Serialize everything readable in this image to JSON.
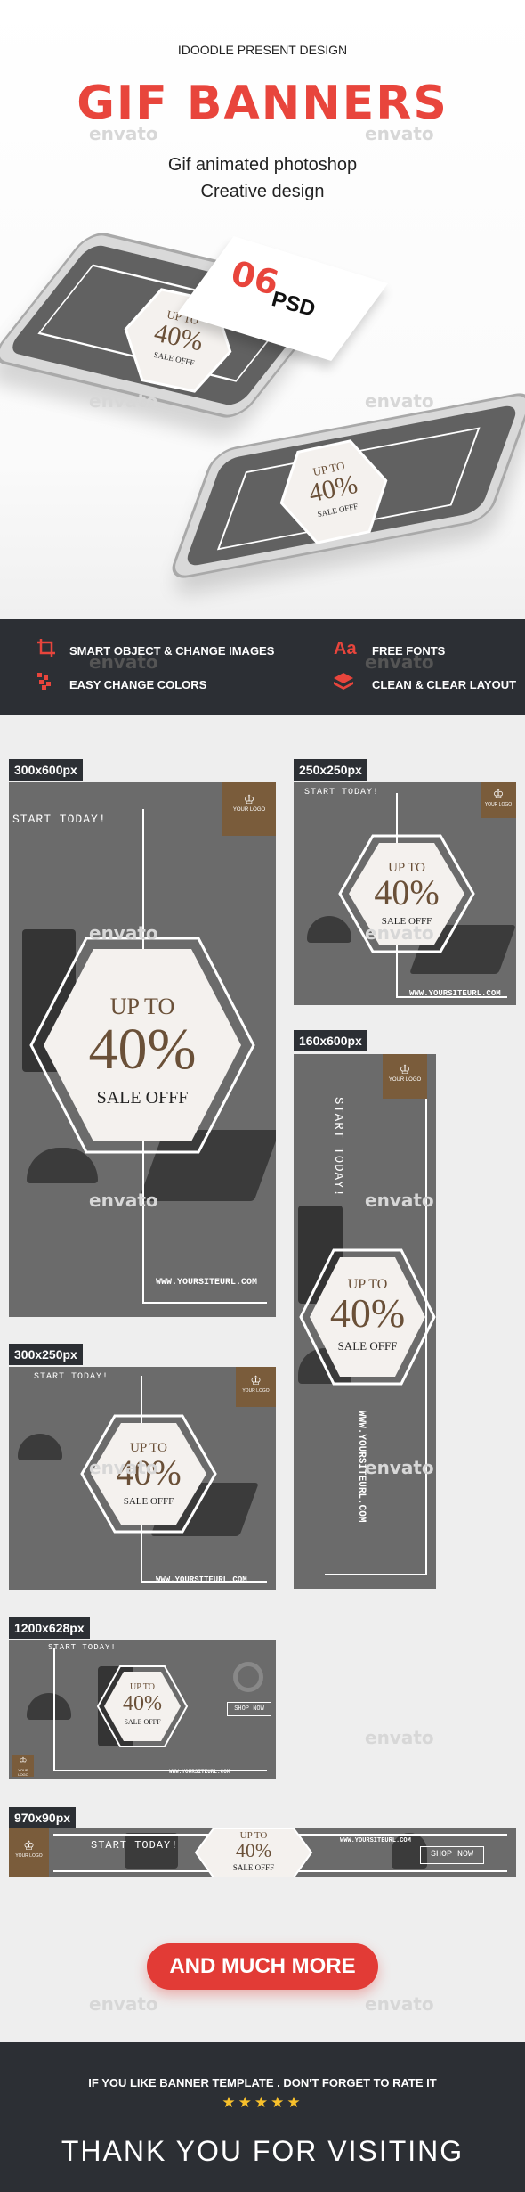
{
  "header": {
    "presenter": "IDOODLE PRESENT DESIGN",
    "title": "GIF BANNERS",
    "subtitle_1": "Gif animated photoshop",
    "subtitle_2": "Creative design"
  },
  "watermark": "envato",
  "badge": {
    "number": "06",
    "label": "PSD"
  },
  "features": {
    "items": [
      {
        "icon": "crop-icon",
        "label": "SMART OBJECT & CHANGE IMAGES"
      },
      {
        "icon": "palette-icon",
        "label": "EASY CHANGE COLORS"
      },
      {
        "icon": "font-icon",
        "label": "FREE FONTS",
        "glyph": "Aa"
      },
      {
        "icon": "layers-icon",
        "label": "CLEAN & CLEAR LAYOUT"
      }
    ]
  },
  "banner_text": {
    "start": "START TODAY!",
    "up_to": "UP TO",
    "percent": "40%",
    "sale": "SALE OFFF",
    "url": "WWW.YOURSITEURL.COM",
    "logo": "YOUR LOGO",
    "shop": "SHOP NOW"
  },
  "sizes": {
    "s300x600": "300x600px",
    "s250x250": "250x250px",
    "s160x600": "160x600px",
    "s300x250": "300x250px",
    "s1200x628": "1200x628px",
    "s970x90": "970x90px"
  },
  "cta": {
    "label": "AND MUCH MORE"
  },
  "footer": {
    "rate": "IF YOU LIKE BANNER TEMPLATE . DON'T FORGET TO RATE IT",
    "stars": "★★★★★",
    "thanks": "THANK YOU FOR VISITING"
  },
  "colors": {
    "accent": "#e8453c",
    "dark": "#2c2f34",
    "logo_brown": "#7a5c3b",
    "banner_gray": "#6b6b6b"
  }
}
